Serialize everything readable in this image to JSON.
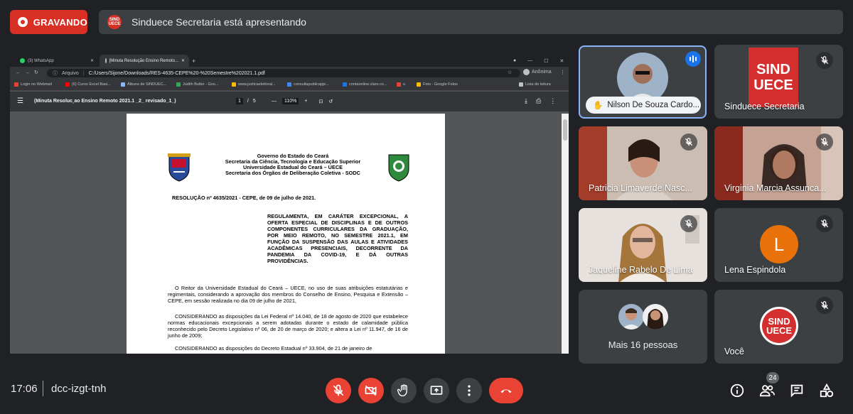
{
  "recording": {
    "label": "GRAVANDO"
  },
  "presenting": {
    "text": "Sinduece Secretaria está apresentando"
  },
  "browser": {
    "tabs": [
      "(3) WhatsApp",
      "[Minuta Resolução Ensino Remoto..."
    ],
    "file_label": "Arquivo",
    "url": "C:/Users/Sijone/Downloads/RES-4635-CEPE%20-%20Semestre%202021.1.pdf",
    "profile": "Anônima",
    "bookmarks": [
      "Login no Webmail",
      "(6) Curso Excel Basi...",
      "Álbuns de SINDUEC...",
      "Judith Butler - Goo...",
      "www.justicaeleitoral...",
      "consultapublicapje...",
      "contaonline.claro.co...",
      "u",
      "Foto - Google Fotos"
    ],
    "reading_list": "Lista de leitura"
  },
  "pdf": {
    "title": "(Minuta Resoluc¸ao Ensino Remoto 2021.1 _2_ revisado_1_)",
    "page_current": "1",
    "page_total": "5",
    "zoom": "110%",
    "header": [
      "Governo do Estado do Ceará",
      "Secretaria da Ciência, Tecnologia e Educação Superior",
      "Universidade Estadual do Ceará – UECE",
      "Secretaria dos Órgãos de Deliberação Coletiva - SODC"
    ],
    "resolution": "RESOLUÇÃO nº 4635/2021 - CEPE, de 09 de julho de 2021.",
    "summary": "REGULAMENTA, EM CARÁTER EXCEPCIONAL, A OFERTA ESPECIAL DE DISCIPLINAS E DE OUTROS COMPONENTES CURRICULARES DA GRADUAÇÃO, POR MEIO REMOTO, NO SEMESTRE 2021.1, EM FUNÇÃO DA SUSPENSÃO DAS AULAS E ATIVIDADES ACADÊMICAS PRESENCIAIS, DECORRENTE DA PANDEMIA DA COVID-19, E DÁ OUTRAS PROVIDÊNCIAS.",
    "para1": "O Reitor da Universidade Estadual do Ceará – UECE, no uso de suas atribuições estatutárias e regimentais, considerando a aprovação dos membros do Conselho de Ensino, Pesquisa e Extensão – CEPE, em sessão realizada no dia 09 de julho de 2021,",
    "para2": "CONSIDERANDO as disposições da Lei Federal nº 14.040, de 18 de agosto de 2020 que estabelece normas educacionais excepcionais a serem adotadas durante o estado de calamidade pública reconhecido pelo Decreto Legislativo nº 06, de 20 de março de 2020; e altera a Lei nº 11.947, de 16 de junho de 2009;",
    "para3": "CONSIDERANDO as disposições do Decreto Estadual nº 33.904, de 21 de janeiro de"
  },
  "participants": [
    {
      "name": "Nilson De Souza Cardo...",
      "speaking": true
    },
    {
      "name": "Sinduece Secretaria"
    },
    {
      "name": "Patricia Limaverde Nasc..."
    },
    {
      "name": "Virginia Marcia Assunca..."
    },
    {
      "name": "Jaqueline Rabelo De Lima"
    },
    {
      "name": "Lena Espindola",
      "initial": "L",
      "avatar_color": "#e8710a"
    },
    {
      "name": "Mais 16 pessoas"
    },
    {
      "name": "Você"
    }
  ],
  "sind_logo": {
    "line1": "SIND",
    "line2": "UECE"
  },
  "meeting": {
    "time": "17:06",
    "code": "dcc-izgt-tnh",
    "participant_count": "24"
  },
  "colors": {
    "accent_red": "#ea4335",
    "bg": "#202124",
    "tile": "#3c4043",
    "speaking_blue": "#1a73e8"
  }
}
